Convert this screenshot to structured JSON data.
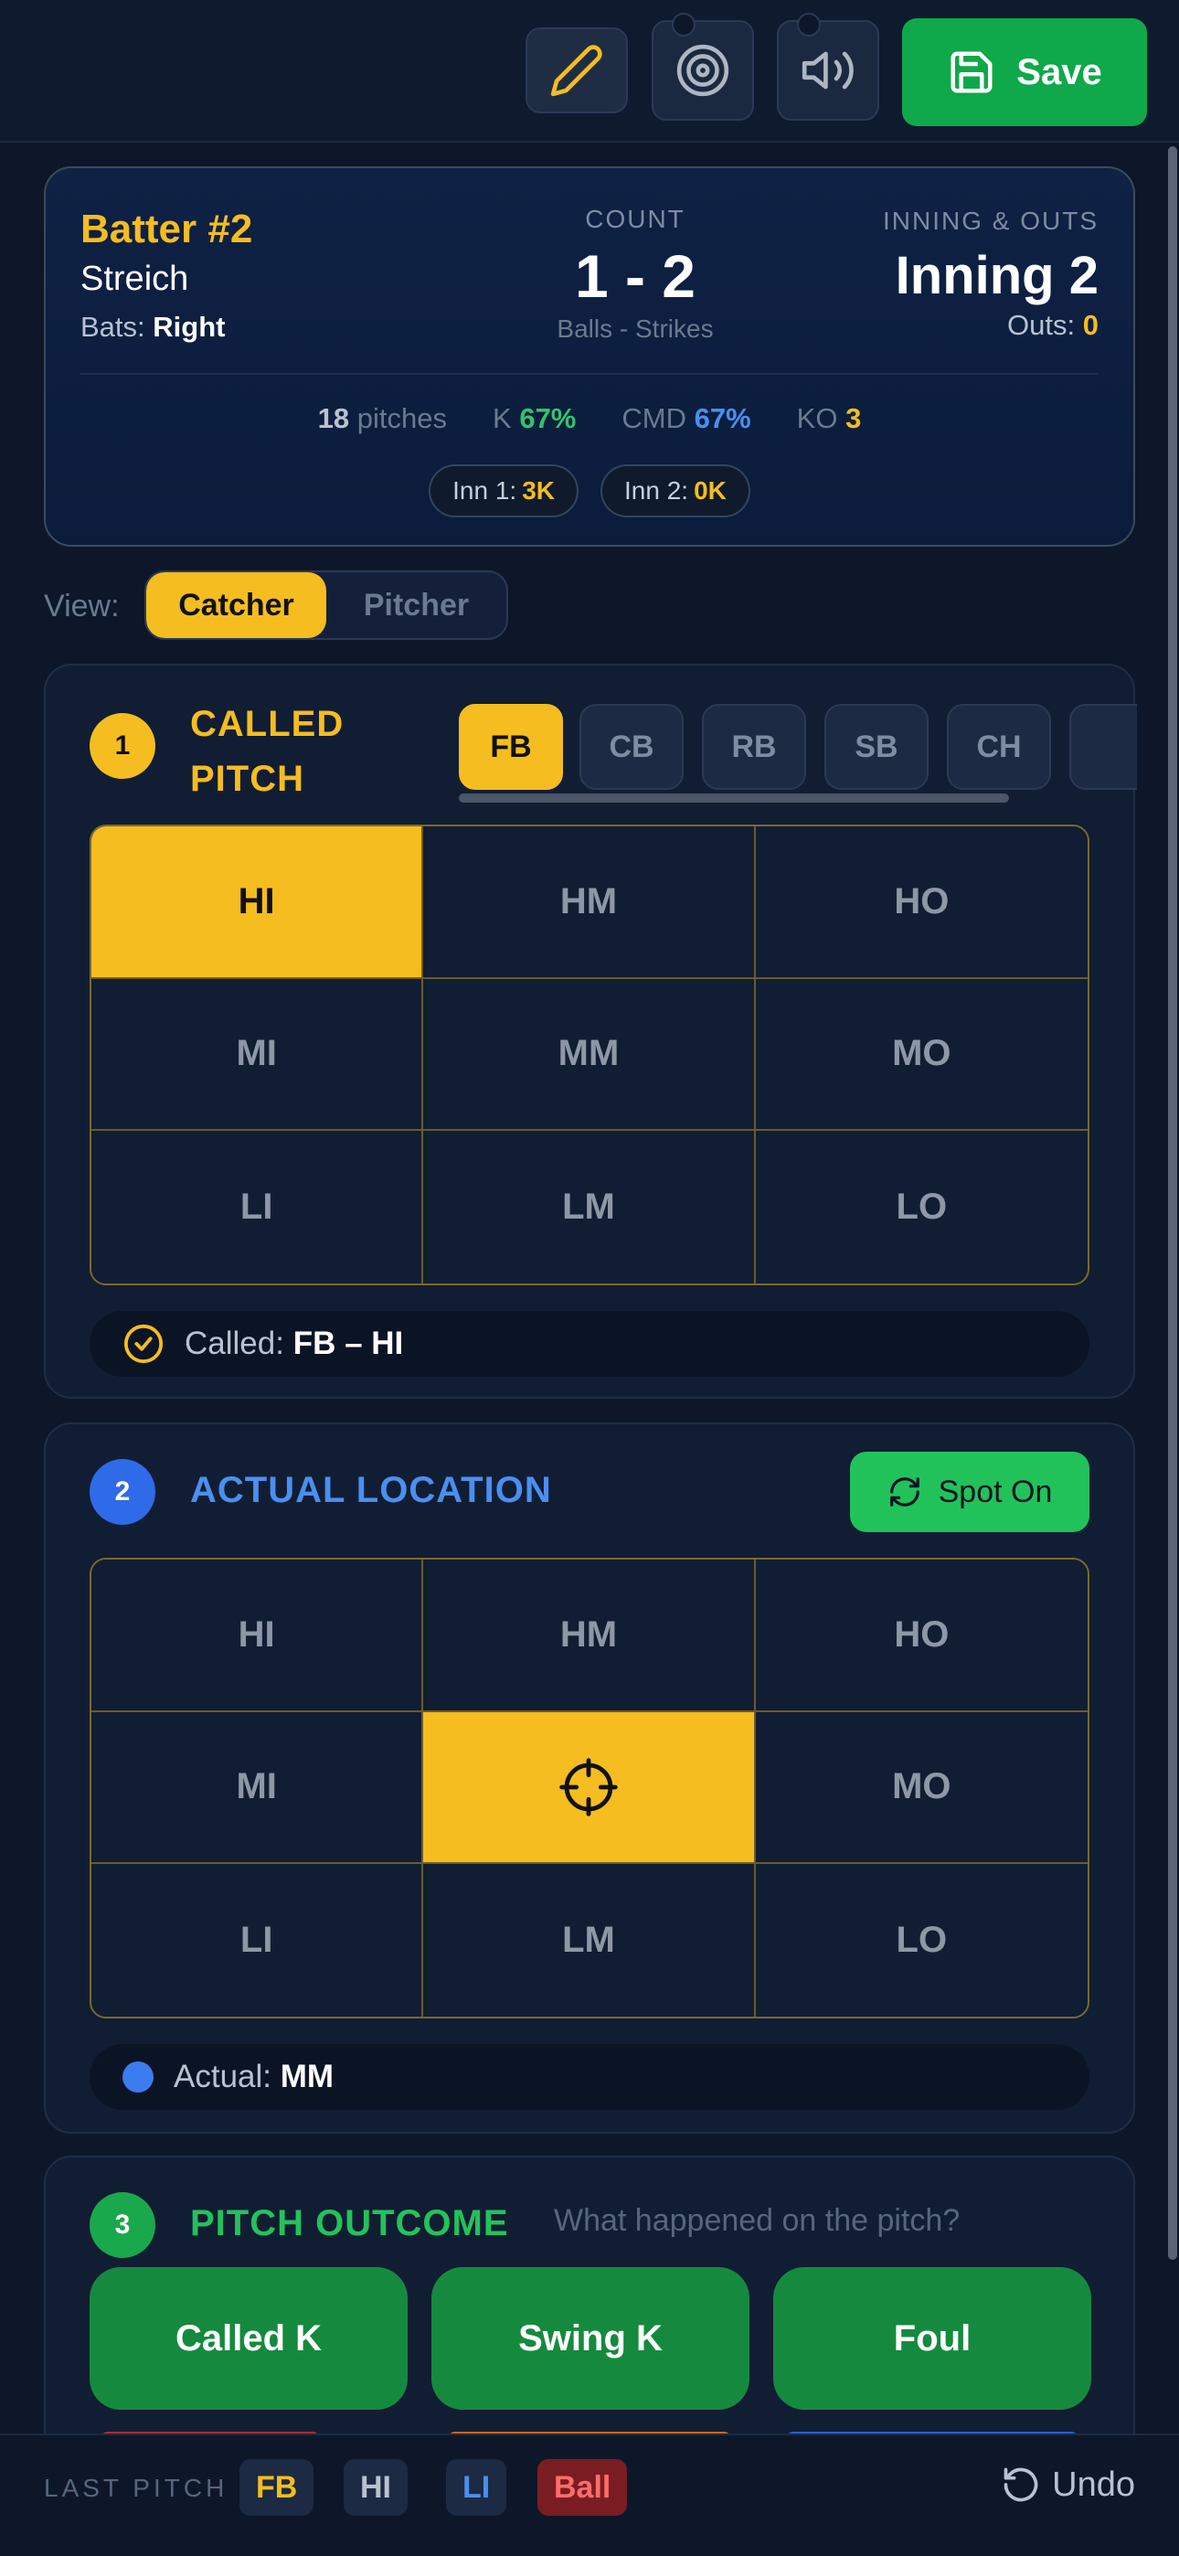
{
  "toolbar": {
    "buttons": [
      "pencil-icon",
      "target-icon",
      "speaker-icon"
    ],
    "save_label": "Save"
  },
  "batter": {
    "name": "Batter #2",
    "sub_name": "Streich",
    "bats_label": "Bats:",
    "bats_value": "Right",
    "count_label": "COUNT",
    "count": "1 - 2",
    "count_sub": "Balls - Strikes",
    "inning_label": "INNING & OUTS",
    "inning": "Inning 2",
    "outs_label": "Outs:",
    "outs_value": "0"
  },
  "stats": {
    "pitches_n": "18",
    "pitches_lbl": "pitches",
    "k_lbl": "K",
    "k_val": "67%",
    "cmd_lbl": "CMD",
    "cmd_val": "67%",
    "ko_lbl": "KO",
    "ko_val": "3"
  },
  "innings": [
    {
      "label": "Inn 1:",
      "value": "3K"
    },
    {
      "label": "Inn 2:",
      "value": "0K"
    }
  ],
  "view": {
    "label": "View:",
    "options": [
      "Catcher",
      "Pitcher"
    ],
    "selected": "Catcher"
  },
  "called_pitch": {
    "number": "1",
    "title_line1": "CALLED",
    "title_line2": "PITCH",
    "pitch_types": [
      "FB",
      "CB",
      "RB",
      "SB",
      "CH"
    ],
    "selected_type": "FB",
    "zones": [
      "HI",
      "HM",
      "HO",
      "MI",
      "MM",
      "MO",
      "LI",
      "LM",
      "LO"
    ],
    "selected_zone": "HI",
    "result_label": "Called:",
    "result_value": "FB – HI"
  },
  "actual_location": {
    "number": "2",
    "title": "ACTUAL LOCATION",
    "spot_on_label": "Spot On",
    "zones": [
      "HI",
      "HM",
      "HO",
      "MI",
      "",
      "MO",
      "LI",
      "LM",
      "LO"
    ],
    "selected_zone": "MM",
    "result_label": "Actual:",
    "result_value": "MM"
  },
  "outcome": {
    "number": "3",
    "title": "PITCH OUTCOME",
    "hint": "What happened on the pitch?",
    "buttons": [
      "Called K",
      "Swing K",
      "Foul"
    ]
  },
  "last_pitch": {
    "label": "LAST PITCH",
    "chips": [
      {
        "text": "FB",
        "color": "#f5bd1f"
      },
      {
        "text": "HI",
        "color": "#b8c2d0"
      },
      {
        "text": "LI",
        "color": "#4a8ff0"
      },
      {
        "text": "Ball",
        "color": "#ff6b6b"
      }
    ],
    "undo_label": "Undo"
  },
  "colors": {
    "accent": "#f5bd1f",
    "save_green": "#0fa84a",
    "blue": "#2f6ae8",
    "background": "#0d1729"
  }
}
